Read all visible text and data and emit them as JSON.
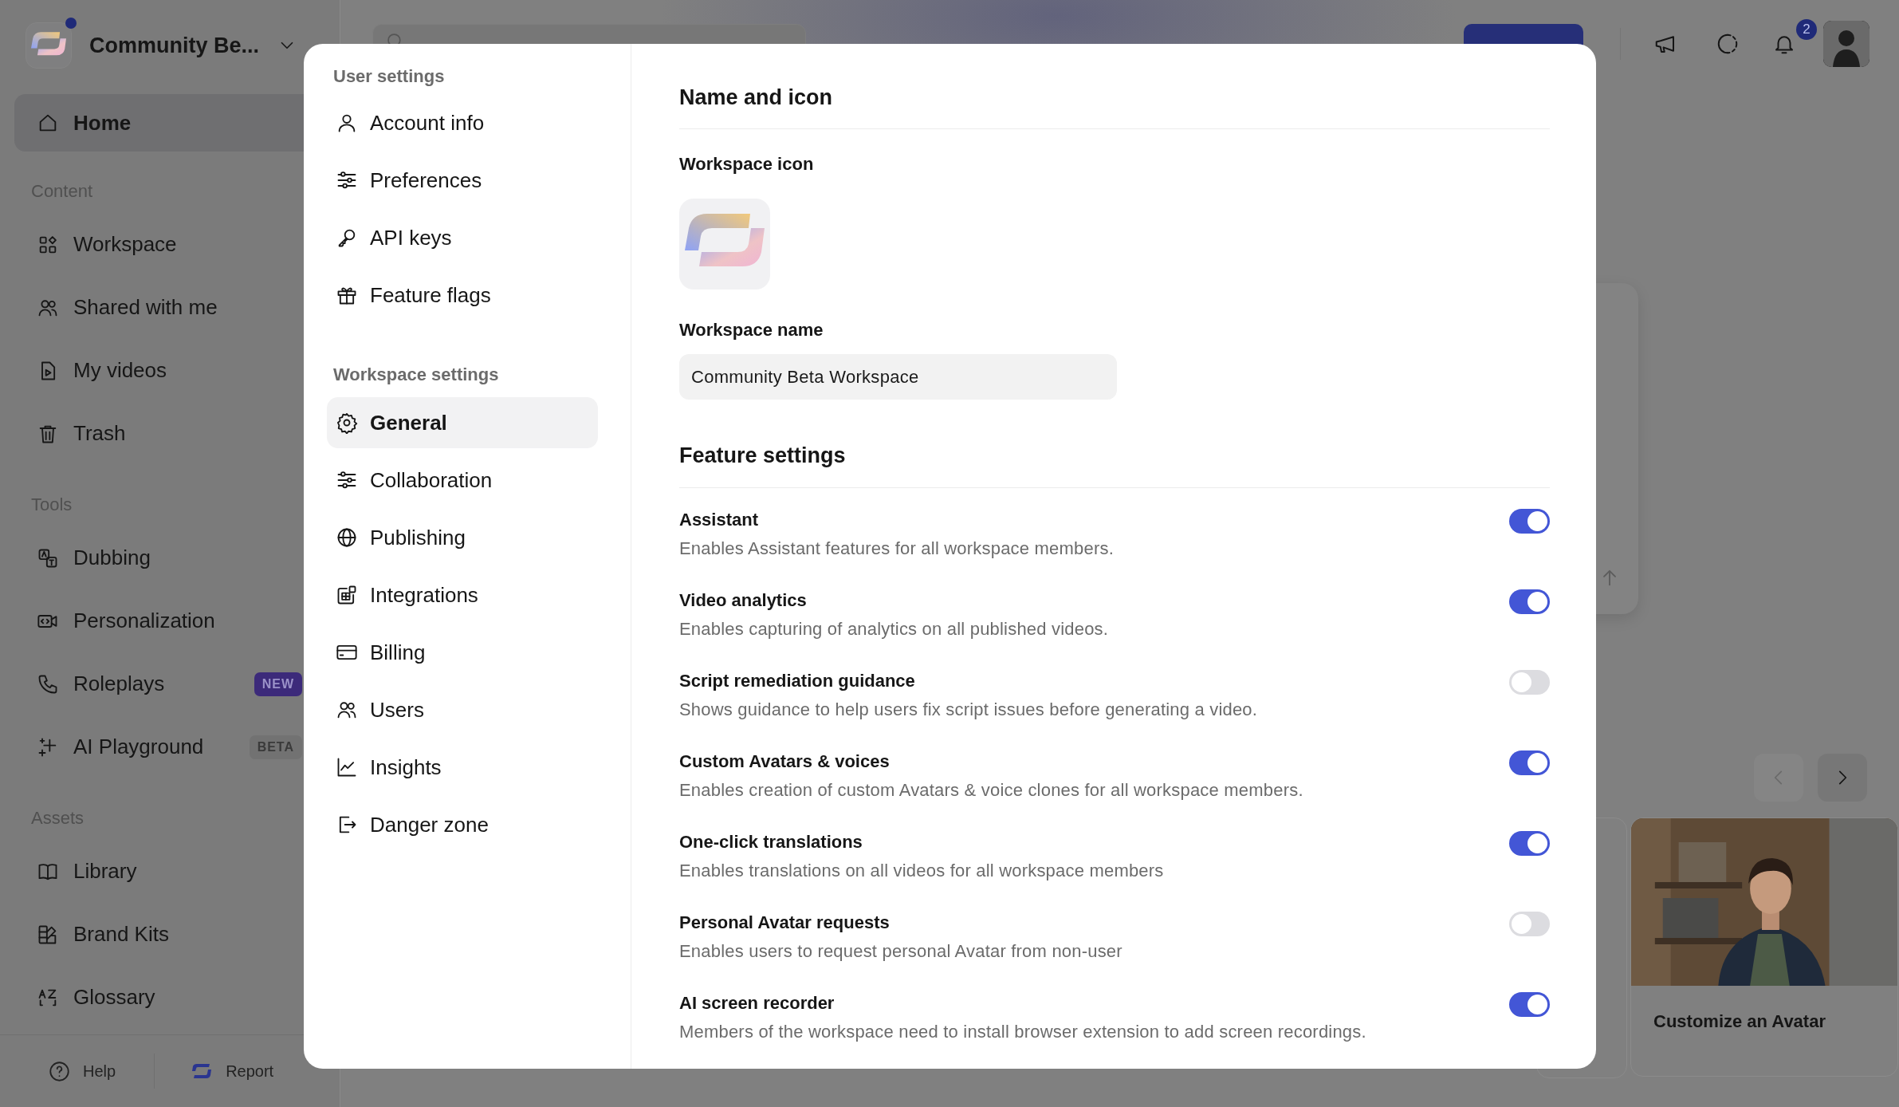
{
  "sidebar": {
    "workspace_name": "Community Be...",
    "unread": true,
    "sections": [
      {
        "items": [
          {
            "label": "Home",
            "selected": true
          }
        ]
      },
      {
        "title": "Content",
        "items": [
          {
            "label": "Workspace",
            "selected": false
          },
          {
            "label": "Shared with me",
            "selected": false
          },
          {
            "label": "My videos",
            "selected": false
          },
          {
            "label": "Trash",
            "selected": false
          }
        ]
      },
      {
        "title": "Tools",
        "items": [
          {
            "label": "Dubbing",
            "selected": false
          },
          {
            "label": "Personalization",
            "selected": false
          },
          {
            "label": "Roleplays",
            "selected": false,
            "badge": {
              "text": "NEW",
              "kind": "new"
            }
          },
          {
            "label": "AI Playground",
            "selected": false,
            "badge": {
              "text": "BETA",
              "kind": "beta"
            }
          }
        ]
      },
      {
        "title": "Assets",
        "items": [
          {
            "label": "Library",
            "selected": false
          },
          {
            "label": "Brand Kits",
            "selected": false
          },
          {
            "label": "Glossary",
            "selected": false
          }
        ]
      }
    ],
    "footer": [
      "Help",
      "Report"
    ]
  },
  "topbar": {
    "notifications": "2"
  },
  "cards": [
    {
      "title": "Customize an Avatar"
    }
  ],
  "modal": {
    "nav": [
      {
        "title": "User settings",
        "items": [
          {
            "label": "Account info",
            "selected": false
          },
          {
            "label": "Preferences",
            "selected": false
          },
          {
            "label": "API keys",
            "selected": false
          },
          {
            "label": "Feature flags",
            "selected": false
          }
        ]
      },
      {
        "title": "Workspace settings",
        "items": [
          {
            "label": "General",
            "selected": true
          },
          {
            "label": "Collaboration",
            "selected": false
          },
          {
            "label": "Publishing",
            "selected": false
          },
          {
            "label": "Integrations",
            "selected": false
          },
          {
            "label": "Billing",
            "selected": false
          },
          {
            "label": "Users",
            "selected": false
          },
          {
            "label": "Insights",
            "selected": false
          },
          {
            "label": "Danger zone",
            "selected": false
          }
        ]
      }
    ],
    "content": {
      "heading": "Name and icon",
      "icon_label": "Workspace icon",
      "name_label": "Workspace name",
      "name_value": "Community Beta Workspace",
      "features_heading": "Feature settings",
      "features": [
        {
          "title": "Assistant",
          "description": "Enables Assistant features for all workspace members.",
          "on": true
        },
        {
          "title": "Video analytics",
          "description": "Enables capturing of analytics on all published videos.",
          "on": true
        },
        {
          "title": "Script remediation guidance",
          "description": "Shows guidance to help users fix script issues before generating a video.",
          "on": false
        },
        {
          "title": "Custom Avatars & voices",
          "description": "Enables creation of custom Avatars & voice clones for all workspace members.",
          "on": true
        },
        {
          "title": "One-click translations",
          "description": "Enables translations on all videos for all workspace members",
          "on": true
        },
        {
          "title": "Personal Avatar requests",
          "description": "Enables users to request personal Avatar from non-user",
          "on": false
        },
        {
          "title": "AI screen recorder",
          "description": "Members of the workspace need to install browser extension to add screen recordings.",
          "on": true
        }
      ]
    }
  }
}
